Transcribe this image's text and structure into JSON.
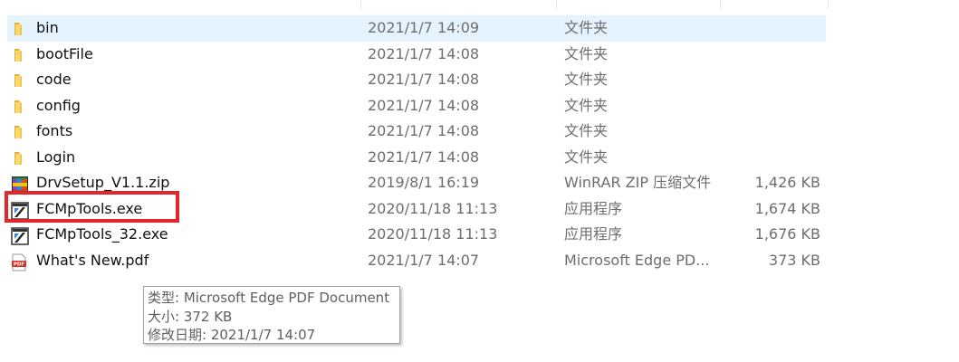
{
  "files": [
    {
      "name": "bin",
      "date": "2021/1/7 14:09",
      "type": "文件夹",
      "size": "",
      "icon": "folder-icon",
      "selected": true
    },
    {
      "name": "bootFile",
      "date": "2021/1/7 14:08",
      "type": "文件夹",
      "size": "",
      "icon": "folder-icon"
    },
    {
      "name": "code",
      "date": "2021/1/7 14:08",
      "type": "文件夹",
      "size": "",
      "icon": "folder-icon"
    },
    {
      "name": "config",
      "date": "2021/1/7 14:08",
      "type": "文件夹",
      "size": "",
      "icon": "folder-icon"
    },
    {
      "name": "fonts",
      "date": "2021/1/7 14:08",
      "type": "文件夹",
      "size": "",
      "icon": "folder-icon"
    },
    {
      "name": "Login",
      "date": "2021/1/7 14:08",
      "type": "文件夹",
      "size": "",
      "icon": "folder-icon"
    },
    {
      "name": "DrvSetup_V1.1.zip",
      "date": "2019/8/1 16:19",
      "type": "WinRAR ZIP 压缩文件",
      "size": "1,426 KB",
      "icon": "winrar-archive-icon"
    },
    {
      "name": "FCMpTools.exe",
      "date": "2020/11/18 11:13",
      "type": "应用程序",
      "size": "1,674 KB",
      "icon": "app-exe-icon",
      "highlighted": true
    },
    {
      "name": "FCMpTools_32.exe",
      "date": "2020/11/18 11:13",
      "type": "应用程序",
      "size": "1,676 KB",
      "icon": "app-exe-icon"
    },
    {
      "name": "What's New.pdf",
      "date": "2021/1/7 14:07",
      "type": "Microsoft Edge PD...",
      "size": "373 KB",
      "icon": "pdf-file-icon"
    }
  ],
  "tooltip": {
    "type_line": "类型: Microsoft Edge PDF Document",
    "size_line": "大小: 372 KB",
    "modified_line": "修改日期: 2021/1/7 14:07"
  },
  "colors": {
    "selected_row": "#e5f3ff",
    "highlight_box": "#e0282c",
    "folder": "#f4c542"
  }
}
